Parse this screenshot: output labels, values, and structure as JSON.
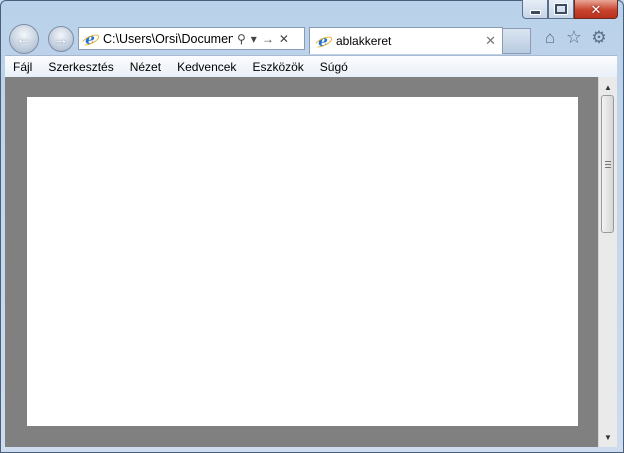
{
  "window": {
    "caption": {
      "minimize_icon": "minimize-icon",
      "maximize_icon": "maximize-icon",
      "close_glyph": "✕"
    }
  },
  "nav": {
    "back_glyph": "←",
    "forward_glyph": "→"
  },
  "address_bar": {
    "value": "C:\\Users\\Orsi\\Document",
    "search_glyph": "⚲",
    "dropdown_glyph": "▾",
    "go_glyph": "→",
    "stop_glyph": "✕"
  },
  "tab": {
    "title": "ablakkeret",
    "close_glyph": "✕"
  },
  "toolbar": {
    "home_glyph": "⌂",
    "favorites_glyph": "☆",
    "tools_glyph": "⚙"
  },
  "menubar": {
    "items": [
      "Fájl",
      "Szerkesztés",
      "Nézet",
      "Kedvencek",
      "Eszközök",
      "Súgó"
    ]
  },
  "scrollbar": {
    "up_glyph": "▲",
    "down_glyph": "▼"
  },
  "colors": {
    "frame": "#c3d6ec",
    "content_bg": "#808080",
    "page_bg": "#ffffff",
    "close_red": "#c8452f"
  }
}
